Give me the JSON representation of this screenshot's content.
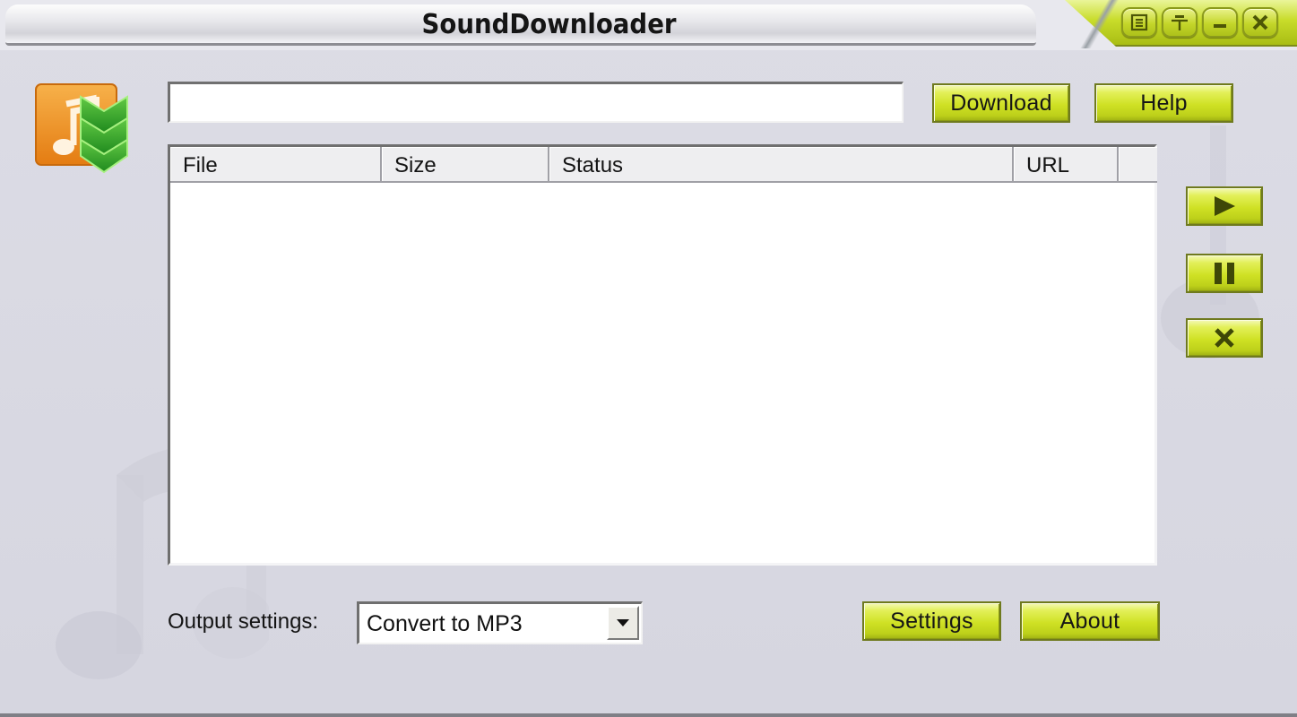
{
  "window": {
    "title": "SoundDownloader",
    "controls": [
      {
        "name": "menu",
        "icon": "menu-icon"
      },
      {
        "name": "pin",
        "icon": "pin-icon"
      },
      {
        "name": "minimize",
        "icon": "minimize-icon"
      },
      {
        "name": "close",
        "icon": "close-icon"
      }
    ]
  },
  "toolbar": {
    "url_input_value": "",
    "url_input_placeholder": "",
    "download_label": "Download",
    "help_label": "Help"
  },
  "list": {
    "columns": [
      "File",
      "Size",
      "Status",
      "URL"
    ],
    "rows": []
  },
  "side_controls": [
    {
      "name": "play",
      "icon": "play-icon"
    },
    {
      "name": "pause",
      "icon": "pause-icon"
    },
    {
      "name": "stop",
      "icon": "stop-x-icon"
    }
  ],
  "footer": {
    "output_label": "Output settings:",
    "output_selected": "Convert to MP3",
    "settings_label": "Settings",
    "about_label": "About"
  },
  "colors": {
    "accent_lime": "#cfe124",
    "button_border": "#6f7a1e",
    "logo_orange": "#f0901e",
    "logo_green": "#3aa82a",
    "window_bg": "#d8d8e2"
  }
}
